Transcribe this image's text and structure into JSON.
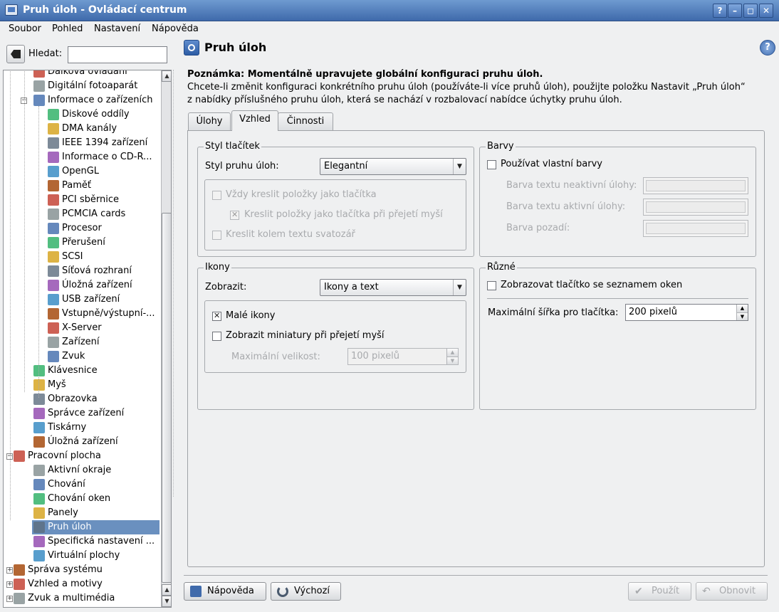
{
  "window": {
    "title": "Pruh úloh - Ovládací centrum",
    "buttons": [
      "?",
      "–",
      "◻",
      "✕"
    ]
  },
  "menu": [
    "Soubor",
    "Pohled",
    "Nastavení",
    "Nápověda"
  ],
  "search": {
    "label": "Hledat:",
    "value": ""
  },
  "tree": [
    {
      "label": "Dálková ovládání",
      "level": 2,
      "icon": "remote-icon"
    },
    {
      "label": "Digitální fotoaparát",
      "level": 2,
      "icon": "camera-icon"
    },
    {
      "label": "Informace o zařízeních",
      "level": 2,
      "icon": "info-icon",
      "expanded": true
    },
    {
      "label": "Diskové oddíly",
      "level": 3,
      "icon": "disk-icon"
    },
    {
      "label": "DMA kanály",
      "level": 3,
      "icon": "chip-icon"
    },
    {
      "label": "IEEE 1394 zařízení",
      "level": 3,
      "icon": "firewire-icon"
    },
    {
      "label": "Informace o CD-R...",
      "level": 3,
      "icon": "cdrom-icon"
    },
    {
      "label": "OpenGL",
      "level": 3,
      "icon": "opengl-icon"
    },
    {
      "label": "Paměť",
      "level": 3,
      "icon": "memory-icon"
    },
    {
      "label": "PCI sběrnice",
      "level": 3,
      "icon": "pci-icon"
    },
    {
      "label": "PCMCIA cards",
      "level": 3,
      "icon": "pcmcia-icon"
    },
    {
      "label": "Procesor",
      "level": 3,
      "icon": "cpu-icon"
    },
    {
      "label": "Přerušení",
      "level": 3,
      "icon": "interrupt-icon"
    },
    {
      "label": "SCSI",
      "level": 3,
      "icon": "scsi-icon"
    },
    {
      "label": "Síťová rozhraní",
      "level": 3,
      "icon": "network-icon"
    },
    {
      "label": "Úložná zařízení",
      "level": 3,
      "icon": "storage-icon"
    },
    {
      "label": "USB zařízení",
      "level": 3,
      "icon": "usb-icon"
    },
    {
      "label": "Vstupně/výstupní-...",
      "level": 3,
      "icon": "io-icon"
    },
    {
      "label": "X-Server",
      "level": 3,
      "icon": "x-icon"
    },
    {
      "label": "Zařízení",
      "level": 3,
      "icon": "device-icon"
    },
    {
      "label": "Zvuk",
      "level": 3,
      "icon": "sound-icon"
    },
    {
      "label": "Klávesnice",
      "level": 2,
      "icon": "keyboard-icon"
    },
    {
      "label": "Myš",
      "level": 2,
      "icon": "mouse-icon"
    },
    {
      "label": "Obrazovka",
      "level": 2,
      "icon": "monitor-icon"
    },
    {
      "label": "Správce zařízení",
      "level": 2,
      "icon": "device-manager-icon"
    },
    {
      "label": "Tiskárny",
      "level": 2,
      "icon": "printer-icon"
    },
    {
      "label": "Úložná zařízení",
      "level": 2,
      "icon": "storage-icon"
    },
    {
      "label": "Pracovní plocha",
      "level": 1,
      "icon": "desktop-icon",
      "expanded": true
    },
    {
      "label": "Aktivní okraje",
      "level": 2,
      "icon": "window-icon"
    },
    {
      "label": "Chování",
      "level": 2,
      "icon": "behavior-icon"
    },
    {
      "label": "Chování oken",
      "level": 2,
      "icon": "window-behavior-icon"
    },
    {
      "label": "Panely",
      "level": 2,
      "icon": "panel-icon"
    },
    {
      "label": "Pruh úloh",
      "level": 2,
      "icon": "taskbar-icon",
      "selected": true
    },
    {
      "label": "Specifická nastavení ...",
      "level": 2,
      "icon": "window-icon"
    },
    {
      "label": "Virtuální plochy",
      "level": 2,
      "icon": "virtual-desktop-icon"
    },
    {
      "label": "Správa systému",
      "level": 1,
      "icon": "admin-icon",
      "collapsed": true
    },
    {
      "label": "Vzhled a motivy",
      "level": 1,
      "icon": "appearance-icon",
      "collapsed": true
    },
    {
      "label": "Zvuk a multimédia",
      "level": 1,
      "icon": "multimedia-icon",
      "collapsed": true
    }
  ],
  "page": {
    "title": "Pruh úloh",
    "note_bold": "Poznámka: Momentálně upravujete globální konfiguraci pruhu úloh.",
    "note_line1": "Chcete-li změnit konfiguraci konkrétního pruhu úloh (používáte-li více pruhů úloh), použijte položku Nastavit „Pruh úloh“",
    "note_line2": "z nabídky příslušného pruhu úloh, která se nachází v rozbalovací nabídce úchytky pruhu úloh."
  },
  "tabs": [
    "Úlohy",
    "Vzhled",
    "Činnosti"
  ],
  "button_style": {
    "title": "Styl tlačítek",
    "label": "Styl pruhu úloh:",
    "value": "Elegantní",
    "always_buttons": "Vždy kreslit položky jako tlačítka",
    "hover_buttons": "Kreslit položky jako tlačítka při přejetí myší",
    "halo": "Kreslit kolem textu svatozář"
  },
  "colors": {
    "title": "Barvy",
    "custom": "Používat vlastní barvy",
    "inactive": "Barva textu neaktivní úlohy:",
    "active": "Barva textu aktivní úlohy:",
    "background": "Barva pozadí:"
  },
  "icons": {
    "title": "Ikony",
    "label": "Zobrazit:",
    "value": "Ikony a text",
    "small": "Malé ikony",
    "thumbs": "Zobrazit miniatury při přejetí myší",
    "max_label": "Maximální velikost:",
    "max_value": "100 pixelů"
  },
  "misc": {
    "title": "Různé",
    "show_list": "Zobrazovat tlačítko se seznamem oken",
    "width_label": "Maximální šířka pro tlačítka:",
    "width_value": "200 pixelů"
  },
  "footer": {
    "help": "Nápověda",
    "defaults": "Výchozí",
    "apply": "Použít",
    "reset": "Obnovit"
  },
  "accent": "#6a90bf"
}
